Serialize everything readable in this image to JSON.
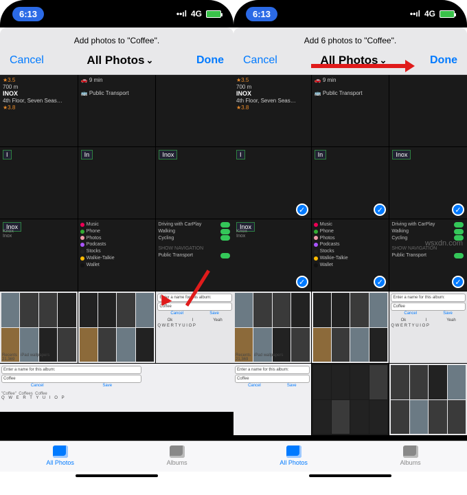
{
  "status": {
    "time": "6:13",
    "net": "4G",
    "signal": "••ıl"
  },
  "left": {
    "title": "Add photos to \"Coffee\".",
    "cancel": "Cancel",
    "center": "All Photos",
    "done": "Done"
  },
  "right": {
    "title": "Add 6 photos to \"Coffee\".",
    "cancel": "Cancel",
    "center": "All Photos",
    "done": "Done"
  },
  "tabs": {
    "all": "All Photos",
    "albums": "Albums"
  },
  "thumbs": {
    "rating": "★3.5",
    "dist": "700 m",
    "inox": "INOX",
    "addr": "4th Floor, Seven Seas…",
    "ratinga": "★3.8",
    "drive": "9 min",
    "pt": "Public Transport",
    "i": "I",
    "in": "In",
    "inox_t": "Inox",
    "knox": "Knox",
    "settings": {
      "music": "Music",
      "phone": "Phone",
      "photos": "Photos",
      "podcasts": "Podcasts",
      "stocks": "Stocks",
      "walkie": "Walkie-Talkie",
      "wallet": "Wallet"
    },
    "nav": {
      "carplay": "Driving with CarPlay",
      "walking": "Walking",
      "cycling": "Cycling",
      "show": "SHOW NAVIGATION",
      "pt": "Public Transport"
    },
    "album_prompt": "Enter a name for this album:",
    "coffee": "Coffee",
    "coffee1": "\"Coffee\"",
    "coffees": "Coffees",
    "save": "Save",
    "cancel": "Cancel",
    "recents": "Recents",
    "ipad": "iPad wallpapers",
    "count": "21,369",
    "ok": "Ok",
    "idk": "I",
    "yeah": "Yeah",
    "keys": "Q W E R T Y U I O P"
  },
  "watermark": "wsxdn.com"
}
